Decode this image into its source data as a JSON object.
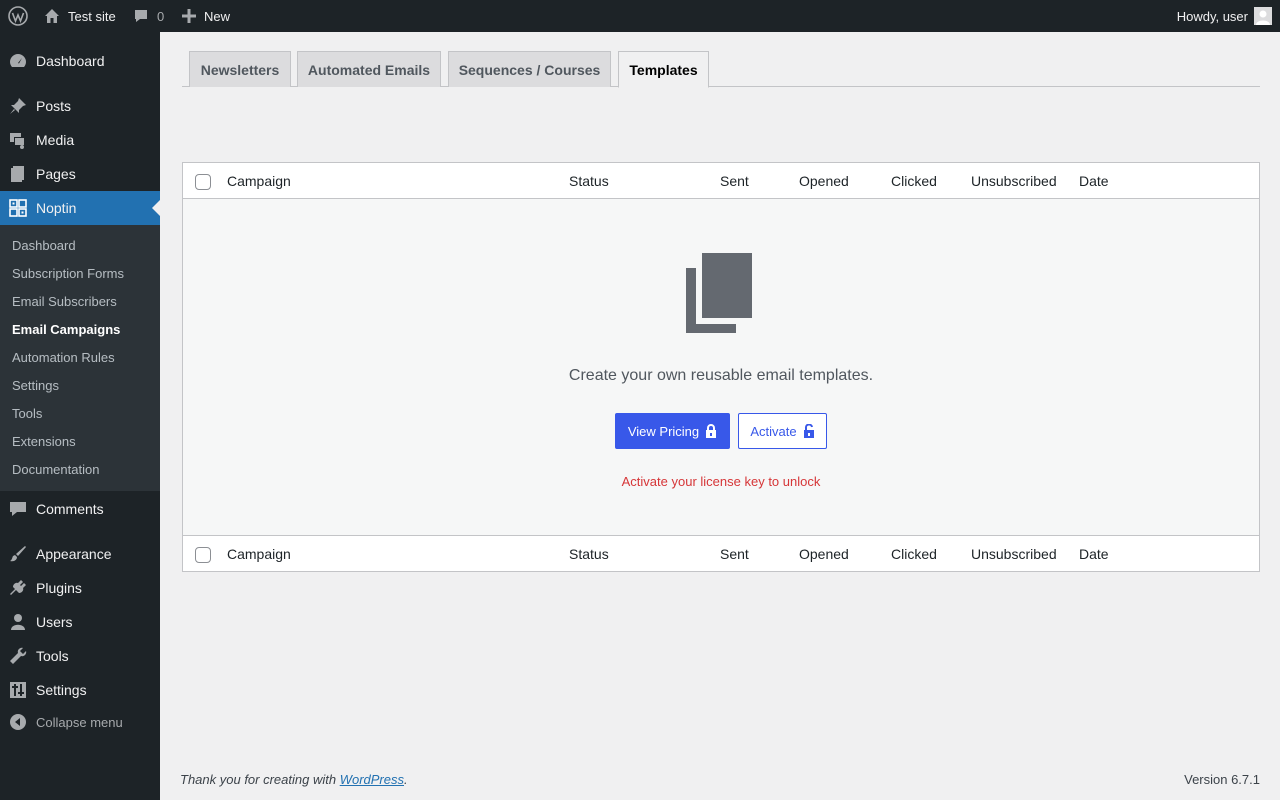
{
  "adminbar": {
    "site_name": "Test site",
    "comments_count": "0",
    "new_label": "New",
    "howdy": "Howdy, user"
  },
  "menu": {
    "items": [
      {
        "label": "Dashboard",
        "icon": "dashboard-icon"
      },
      {
        "label": "Posts",
        "icon": "pin-icon"
      },
      {
        "label": "Media",
        "icon": "media-icon"
      },
      {
        "label": "Pages",
        "icon": "pages-icon"
      },
      {
        "label": "Noptin",
        "icon": "noptin-icon"
      },
      {
        "label": "Comments",
        "icon": "comment-icon"
      },
      {
        "label": "Appearance",
        "icon": "brush-icon"
      },
      {
        "label": "Plugins",
        "icon": "plug-icon"
      },
      {
        "label": "Users",
        "icon": "user-icon"
      },
      {
        "label": "Tools",
        "icon": "wrench-icon"
      },
      {
        "label": "Settings",
        "icon": "sliders-icon"
      }
    ],
    "submenu": [
      "Dashboard",
      "Subscription Forms",
      "Email Subscribers",
      "Email Campaigns",
      "Automation Rules",
      "Settings",
      "Tools",
      "Extensions",
      "Documentation"
    ],
    "collapse_label": "Collapse menu"
  },
  "tabs": [
    "Newsletters",
    "Automated Emails",
    "Sequences / Courses",
    "Templates"
  ],
  "table": {
    "columns": [
      "Campaign",
      "Status",
      "Sent",
      "Opened",
      "Clicked",
      "Unsubscribed",
      "Date"
    ]
  },
  "empty_state": {
    "message": "Create your own reusable email templates.",
    "view_pricing": "View Pricing",
    "activate": "Activate",
    "unlock_text": "Activate your license key to unlock"
  },
  "footer": {
    "thanks_prefix": "Thank you for creating with ",
    "wordpress_link": "WordPress",
    "thanks_suffix": ".",
    "version": "Version 6.7.1"
  },
  "colors": {
    "accent": "#2271b1",
    "primary_button": "#3858e9",
    "error": "#d63638"
  }
}
